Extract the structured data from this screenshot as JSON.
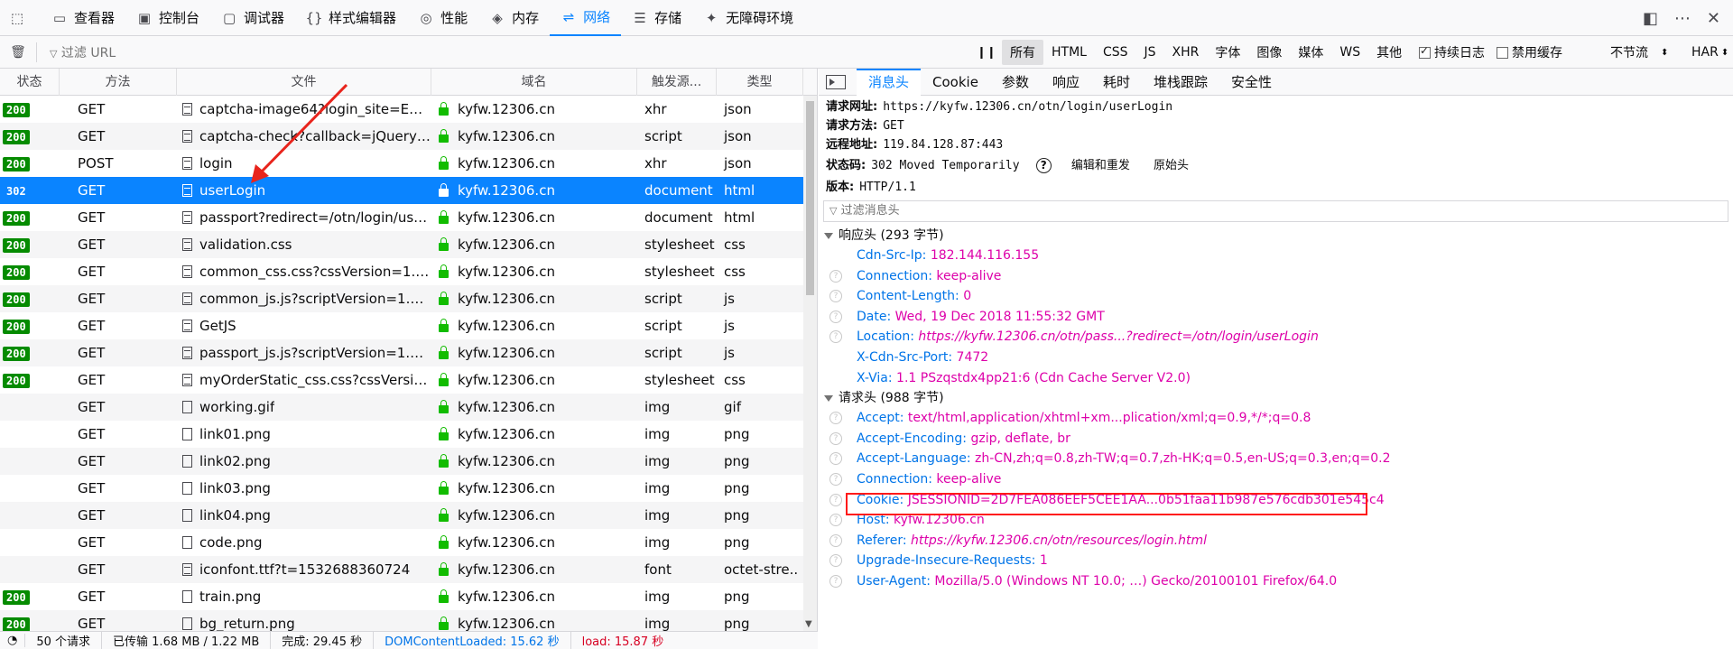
{
  "toolbar": {
    "tools": [
      {
        "label": "查看器",
        "icon": "inspector-icon"
      },
      {
        "label": "控制台",
        "icon": "console-icon"
      },
      {
        "label": "调试器",
        "icon": "debugger-icon"
      },
      {
        "label": "样式编辑器",
        "icon": "style-editor-icon"
      },
      {
        "label": "性能",
        "icon": "performance-icon"
      },
      {
        "label": "内存",
        "icon": "memory-icon"
      },
      {
        "label": "网络",
        "icon": "network-icon"
      },
      {
        "label": "存储",
        "icon": "storage-icon"
      },
      {
        "label": "无障碍环境",
        "icon": "accessibility-icon"
      }
    ],
    "active_tool": "网络"
  },
  "filterbar": {
    "placeholder": "过滤 URL",
    "types": [
      "所有",
      "HTML",
      "CSS",
      "JS",
      "XHR",
      "字体",
      "图像",
      "媒体",
      "WS",
      "其他"
    ],
    "selected_type": "所有",
    "persist_log": "持续日志",
    "persist_log_checked": true,
    "disable_cache": "禁用缓存",
    "disable_cache_checked": false,
    "throttle": "不节流",
    "har": "HAR"
  },
  "table": {
    "columns": [
      "状态",
      "方法",
      "文件",
      "域名",
      "触发源...",
      "类型"
    ],
    "rows": [
      {
        "status": "200",
        "method": "GET",
        "file": "captcha-image64?login_site=E&mod...",
        "domain": "kyfw.12306.cn",
        "cause": "xhr",
        "type": "json"
      },
      {
        "status": "200",
        "method": "GET",
        "file": "captcha-check?callback=jQuery1910...",
        "domain": "kyfw.12306.cn",
        "cause": "script",
        "type": "json"
      },
      {
        "status": "200",
        "method": "POST",
        "file": "login",
        "domain": "kyfw.12306.cn",
        "cause": "xhr",
        "type": "json"
      },
      {
        "status": "302",
        "method": "GET",
        "file": "userLogin",
        "domain": "kyfw.12306.cn",
        "cause": "document",
        "type": "html",
        "selected": true
      },
      {
        "status": "200",
        "method": "GET",
        "file": "passport?redirect=/otn/login/userLo...",
        "domain": "kyfw.12306.cn",
        "cause": "document",
        "type": "html"
      },
      {
        "status": "200",
        "method": "GET",
        "file": "validation.css",
        "domain": "kyfw.12306.cn",
        "cause": "stylesheet",
        "type": "css"
      },
      {
        "status": "200",
        "method": "GET",
        "file": "common_css.css?cssVersion=1.9049",
        "domain": "kyfw.12306.cn",
        "cause": "stylesheet",
        "type": "css"
      },
      {
        "status": "200",
        "method": "GET",
        "file": "common_js.js?scriptVersion=1.9111",
        "domain": "kyfw.12306.cn",
        "cause": "script",
        "type": "js"
      },
      {
        "status": "200",
        "method": "GET",
        "file": "GetJS",
        "domain": "kyfw.12306.cn",
        "cause": "script",
        "type": "js"
      },
      {
        "status": "200",
        "method": "GET",
        "file": "passport_js.js?scriptVersion=1.9111",
        "domain": "kyfw.12306.cn",
        "cause": "script",
        "type": "js"
      },
      {
        "status": "200",
        "method": "GET",
        "file": "myOrderStatic_css.css?cssVersion=1....",
        "domain": "kyfw.12306.cn",
        "cause": "stylesheet",
        "type": "css"
      },
      {
        "status": "",
        "method": "GET",
        "file": "working.gif",
        "domain": "kyfw.12306.cn",
        "cause": "img",
        "type": "gif"
      },
      {
        "status": "",
        "method": "GET",
        "file": "link01.png",
        "domain": "kyfw.12306.cn",
        "cause": "img",
        "type": "png"
      },
      {
        "status": "",
        "method": "GET",
        "file": "link02.png",
        "domain": "kyfw.12306.cn",
        "cause": "img",
        "type": "png"
      },
      {
        "status": "",
        "method": "GET",
        "file": "link03.png",
        "domain": "kyfw.12306.cn",
        "cause": "img",
        "type": "png"
      },
      {
        "status": "",
        "method": "GET",
        "file": "link04.png",
        "domain": "kyfw.12306.cn",
        "cause": "img",
        "type": "png"
      },
      {
        "status": "",
        "method": "GET",
        "file": "code.png",
        "domain": "kyfw.12306.cn",
        "cause": "img",
        "type": "png"
      },
      {
        "status": "",
        "method": "GET",
        "file": "iconfont.ttf?t=1532688360724",
        "domain": "kyfw.12306.cn",
        "cause": "font",
        "type": "octet-stre..."
      },
      {
        "status": "200",
        "method": "GET",
        "file": "train.png",
        "domain": "kyfw.12306.cn",
        "cause": "img",
        "type": "png"
      },
      {
        "status": "200",
        "method": "GET",
        "file": "bg_return.png",
        "domain": "kyfw.12306.cn",
        "cause": "img",
        "type": "png"
      }
    ]
  },
  "statusbar": {
    "requests": "50 个请求",
    "transferred": "已传输 1.68 MB / 1.22 MB",
    "finish": "完成: 29.45 秒",
    "dcl": "DOMContentLoaded: 15.62 秒",
    "load": "load: 15.87 秒"
  },
  "details": {
    "tabs": [
      "消息头",
      "Cookie",
      "参数",
      "响应",
      "耗时",
      "堆栈跟踪",
      "安全性"
    ],
    "active_tab": "消息头",
    "summary": {
      "url_label": "请求网址:",
      "url": "https://kyfw.12306.cn/otn/login/userLogin",
      "method_label": "请求方法:",
      "method": "GET",
      "remote_label": "远程地址:",
      "remote": "119.84.128.87:443",
      "status_label": "状态码:",
      "status": "302  Moved Temporarily",
      "help": "?",
      "edit_resend": "编辑和重发",
      "raw": "原始头",
      "version_label": "版本:",
      "version": "HTTP/1.1"
    },
    "header_filter_placeholder": "过滤消息头",
    "response_section": "响应头 (293 字节)",
    "response_headers": [
      {
        "name": "Cdn-Src-Ip:",
        "value": "182.144.116.155",
        "help": false
      },
      {
        "name": "Connection:",
        "value": "keep-alive",
        "help": true
      },
      {
        "name": "Content-Length:",
        "value": "0",
        "help": true
      },
      {
        "name": "Date:",
        "value": "Wed, 19 Dec 2018 11:55:32 GMT",
        "help": true
      },
      {
        "name": "Location:",
        "value": "https://kyfw.12306.cn/otn/pass...?redirect=/otn/login/userLogin",
        "help": true,
        "italic": true
      },
      {
        "name": "X-Cdn-Src-Port:",
        "value": "7472",
        "help": false
      },
      {
        "name": "X-Via:",
        "value": "1.1 PSzqstdx4pp21:6 (Cdn Cache Server V2.0)",
        "help": false
      }
    ],
    "request_section": "请求头 (988 字节)",
    "request_headers": [
      {
        "name": "Accept:",
        "value": "text/html,application/xhtml+xm...plication/xml;q=0.9,*/*;q=0.8",
        "help": true
      },
      {
        "name": "Accept-Encoding:",
        "value": "gzip, deflate, br",
        "help": true
      },
      {
        "name": "Accept-Language:",
        "value": "zh-CN,zh;q=0.8,zh-TW;q=0.7,zh-HK;q=0.5,en-US;q=0.3,en;q=0.2",
        "help": true
      },
      {
        "name": "Connection:",
        "value": "keep-alive",
        "help": true
      },
      {
        "name": "Cookie:",
        "value": "JSESSIONID=2D7FEA086EEF5CEE1AA...0b51faa11b987e576cdb301e545c4",
        "help": true,
        "highlighted": true
      },
      {
        "name": "Host:",
        "value": "kyfw.12306.cn",
        "help": true
      },
      {
        "name": "Referer:",
        "value": "https://kyfw.12306.cn/otn/resources/login.html",
        "help": true,
        "italic": true
      },
      {
        "name": "Upgrade-Insecure-Requests:",
        "value": "1",
        "help": true
      },
      {
        "name": "User-Agent:",
        "value": "Mozilla/5.0 (Windows NT 10.0; …) Gecko/20100101 Firefox/64.0",
        "help": true
      }
    ]
  },
  "annotation_color": "#ff1a1a"
}
